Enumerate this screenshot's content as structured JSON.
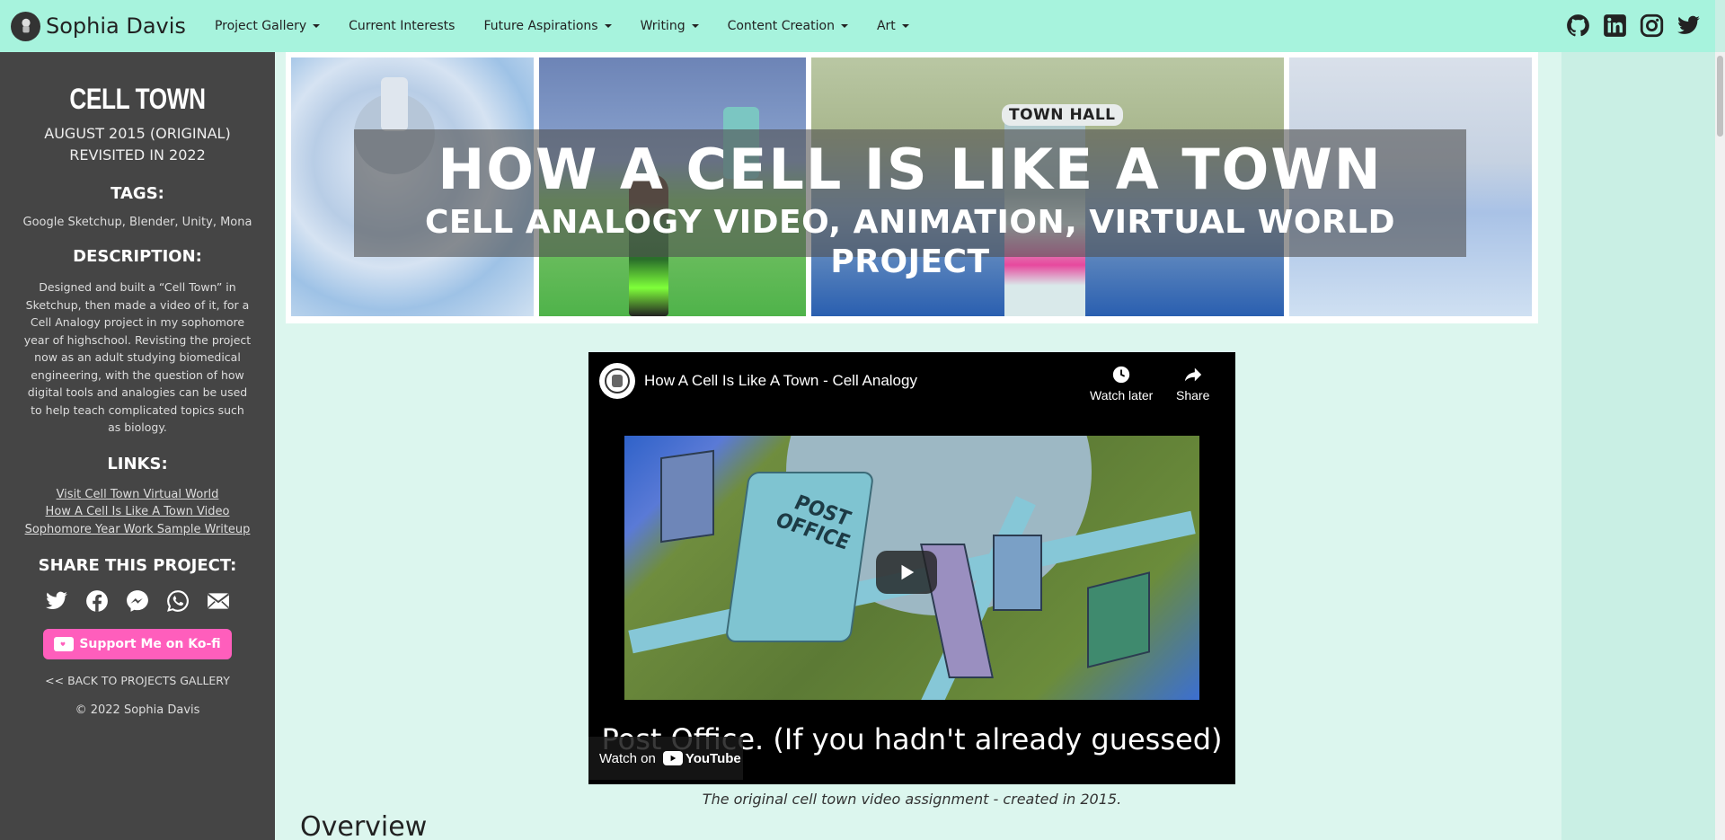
{
  "nav": {
    "brand": "Sophia Davis",
    "items": [
      {
        "label": "Project Gallery",
        "dropdown": true
      },
      {
        "label": "Current Interests",
        "dropdown": false
      },
      {
        "label": "Future Aspirations",
        "dropdown": true
      },
      {
        "label": "Writing",
        "dropdown": true
      },
      {
        "label": "Content Creation",
        "dropdown": true
      },
      {
        "label": "Art",
        "dropdown": true
      }
    ],
    "social_icons": [
      "github-icon",
      "linkedin-icon",
      "instagram-icon",
      "twitter-icon"
    ]
  },
  "sidebar": {
    "title": "CELL TOWN",
    "date_line1": "AUGUST 2015 (ORIGINAL)",
    "date_line2": "REVISITED IN 2022",
    "tags_heading": "TAGS:",
    "tags": "Google Sketchup, Blender, Unity, Mona",
    "description_heading": "DESCRIPTION:",
    "description": "Designed and built a “Cell Town” in Sketchup, then made a video of it, for a Cell Analogy project in my sophomore year of highschool. Revisting the project now as an adult studying biomedical engineering, with the question of how digital tools and analogies can be used to help teach complicated topics such as biology.",
    "links_heading": "LINKS:",
    "links": [
      "Visit Cell Town Virtual World",
      "How A Cell Is Like A Town Video",
      "Sophomore Year Work Sample Writeup"
    ],
    "share_heading": "SHARE THIS PROJECT:",
    "share_icons": [
      "twitter-icon",
      "facebook-icon",
      "messenger-icon",
      "whatsapp-icon",
      "email-icon"
    ],
    "kofi_label": "Support Me on Ko-fi",
    "back_label": "<< BACK TO PROJECTS GALLERY",
    "copyright": "© 2022 Sophia Davis"
  },
  "banner": {
    "title": "HOW A CELL IS LIKE A TOWN",
    "subtitle": "CELL ANALOGY VIDEO, ANIMATION, VIRTUAL WORLD PROJECT",
    "sign": "TOWN HALL"
  },
  "video": {
    "title": "How A Cell Is Like A Town - Cell Analogy",
    "watch_later": "Watch later",
    "share": "Share",
    "building_label": "POST OFFICE",
    "caption_overlay": "Post Office. (If you hadn't already guessed)",
    "watch_on": "Watch on",
    "youtube": "YouTube",
    "caption": "The original cell town video assignment - created in 2015."
  },
  "main": {
    "overview_heading": "Overview"
  },
  "colors": {
    "navbar": "#a7f3dd",
    "sidebar": "#454545",
    "main_bg": "#dcf6ee",
    "kofi": "#ff5ebc"
  }
}
